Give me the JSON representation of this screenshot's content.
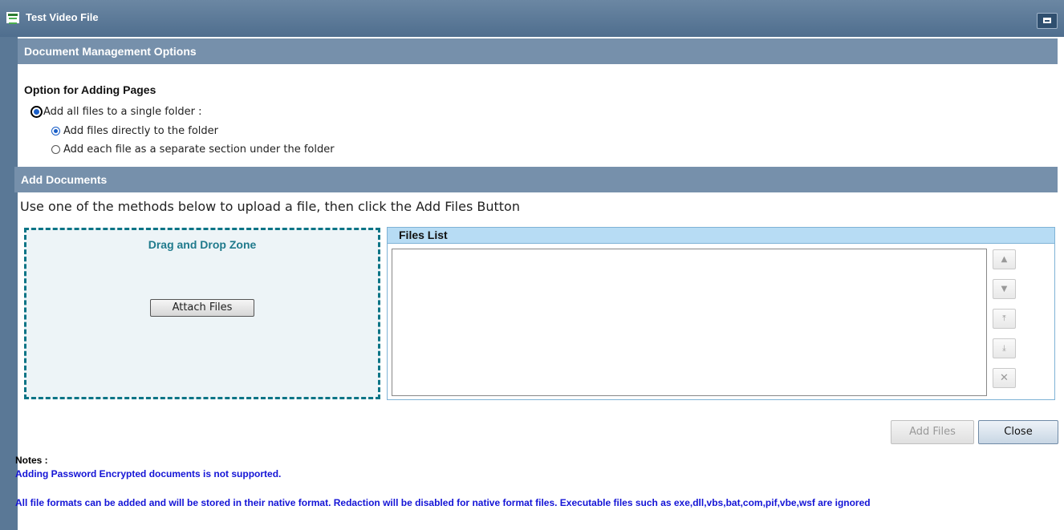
{
  "window": {
    "title": "Test Video File",
    "icon": "window-form-icon",
    "maximize_icon": "maximize-icon"
  },
  "doc_mgmt": {
    "header": "Document Management Options",
    "option_title": "Option for Adding Pages",
    "options": {
      "single_folder": {
        "label": "Add all files to a single folder :",
        "checked": true
      },
      "direct": {
        "label": "Add files directly to the folder",
        "checked": true
      },
      "separate": {
        "label": "Add each file as a separate section under the folder",
        "checked": false
      }
    }
  },
  "add_docs": {
    "header": "Add Documents",
    "instruction": "Use one of the methods below to upload a file, then click the Add Files Button",
    "drop_zone_title": "Drag and Drop Zone",
    "attach_label": "Attach Files",
    "files_list_title": "Files List",
    "side_buttons": {
      "up": "▲",
      "down": "▼",
      "top": "⤒",
      "bottom": "⤓",
      "remove": "✕"
    }
  },
  "actions": {
    "add_files": "Add Files",
    "close": "Close"
  },
  "notes": {
    "label": "Notes :",
    "line1": "Adding Password Encrypted documents is not supported.",
    "line2": "All file formats can be added and will be stored in their native format. Redaction will be disabled for native format files. Executable files such as exe,dll,vbs,bat,com,pif,vbe,wsf are ignored"
  },
  "colors": {
    "titlebar": "#4f6e8e",
    "section_header": "#7690ab",
    "dropzone_border": "#0b7486",
    "files_list_header": "#b7dcf4",
    "note_text": "#1414d6"
  }
}
